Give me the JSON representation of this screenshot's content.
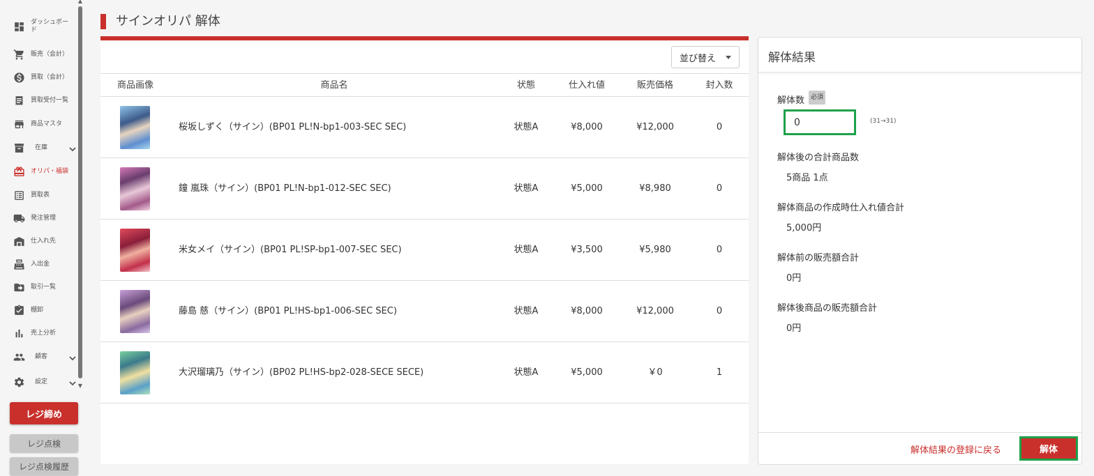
{
  "page": {
    "title": "サインオリパ 解体"
  },
  "sidebar": {
    "items": [
      {
        "label": "ダッシュボード",
        "icon": "dashboard-icon"
      },
      {
        "label": "販売（会計）",
        "icon": "cart-icon"
      },
      {
        "label": "買取（会計）",
        "icon": "dollar-icon"
      },
      {
        "label": "買取受付一覧",
        "icon": "receipt-icon"
      },
      {
        "label": "商品マスタ",
        "icon": "store-icon"
      },
      {
        "label": "在庫",
        "icon": "archive-icon"
      },
      {
        "label": "オリパ・福袋",
        "icon": "gift-icon"
      },
      {
        "label": "買取表",
        "icon": "list-icon"
      },
      {
        "label": "発注管理",
        "icon": "truck-icon"
      },
      {
        "label": "仕入れ先",
        "icon": "warehouse-icon"
      },
      {
        "label": "入出金",
        "icon": "register-icon"
      },
      {
        "label": "取引一覧",
        "icon": "folder-arrow-icon"
      },
      {
        "label": "棚卸",
        "icon": "checklist-icon"
      },
      {
        "label": "売上分析",
        "icon": "bar-chart-icon"
      },
      {
        "label": "顧客",
        "icon": "people-icon"
      },
      {
        "label": "設定",
        "icon": "gear-icon"
      }
    ],
    "close_register": "レジ締め",
    "register_check": "レジ点検",
    "register_check_history": "レジ点検履歴"
  },
  "sort": {
    "label": "並び替え"
  },
  "table": {
    "headers": {
      "image": "商品画像",
      "name": "商品名",
      "condition": "状態",
      "cost": "仕入れ値",
      "price": "販売価格",
      "count": "封入数"
    },
    "rows": [
      {
        "name": "桜坂しずく（サイン）(BP01 PL!N-bp1-003-SEC SEC)",
        "condition": "状態A",
        "cost": "¥8,000",
        "price": "¥12,000",
        "count": "0"
      },
      {
        "name": "鐘 嵐珠（サイン）(BP01 PL!N-bp1-012-SEC SEC)",
        "condition": "状態A",
        "cost": "¥5,000",
        "price": "¥8,980",
        "count": "0"
      },
      {
        "name": "米女メイ（サイン）(BP01 PL!SP-bp1-007-SEC SEC)",
        "condition": "状態A",
        "cost": "¥3,500",
        "price": "¥5,980",
        "count": "0"
      },
      {
        "name": "藤島 慈（サイン）(BP01 PL!HS-bp1-006-SEC SEC)",
        "condition": "状態A",
        "cost": "¥8,000",
        "price": "¥12,000",
        "count": "0"
      },
      {
        "name": "大沢瑠璃乃（サイン）(BP02 PL!HS-bp2-028-SECE SECE)",
        "condition": "状態A",
        "cost": "¥5,000",
        "price": "￥0",
        "count": "1"
      }
    ]
  },
  "result": {
    "title": "解体結果",
    "qty_label": "解体数",
    "required_badge": "必須",
    "qty_value": "0",
    "qty_range": "(31→31)",
    "total_items_label": "解体後の合計商品数",
    "total_items_value": "5商品 1点",
    "cost_total_label": "解体商品の作成時仕入れ値合計",
    "cost_total_value": "5,000円",
    "before_sales_label": "解体前の販売額合計",
    "before_sales_value": "0円",
    "after_sales_label": "解体後商品の販売額合計",
    "after_sales_value": "0円",
    "back_link": "解体結果の登録に戻る",
    "submit": "解体"
  },
  "colors": {
    "accent": "#c9302c",
    "highlight": "#1ea14a"
  }
}
